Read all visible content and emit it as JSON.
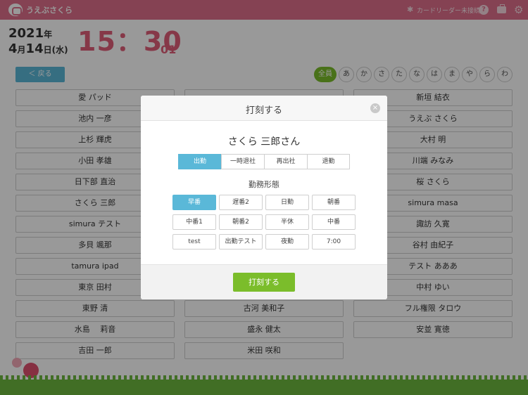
{
  "header": {
    "app_name": "うえぶさくら",
    "card_reader_status": "カードリーダー未接続",
    "help_label": "?",
    "bluetooth_glyph": "✱",
    "settings_glyph": "⚙"
  },
  "clock": {
    "year": "2021",
    "year_unit": "年",
    "month": "4",
    "month_unit": "月",
    "day": "14",
    "day_unit": "日",
    "weekday": "(水)",
    "time": "15：30",
    "seconds": "01"
  },
  "back_button": {
    "label": "＜ 戻る"
  },
  "kana_filter": [
    "全員",
    "あ",
    "か",
    "さ",
    "た",
    "な",
    "は",
    "ま",
    "や",
    "ら",
    "わ"
  ],
  "employees": {
    "col1": [
      "愛 パッド",
      "池内 一彦",
      "上杉 輝虎",
      "小田 孝雄",
      "日下部 直治",
      "さくら 三郎",
      "simura テスト",
      "多貝 颯那",
      "tamura ipad",
      "東京 田村",
      "東野 清",
      "水島　 莉音",
      "吉田 一郎"
    ],
    "col2": [
      "古河 美和子",
      "盛永 健太",
      "米田 咲和"
    ],
    "col3": [
      "新垣 結衣",
      "うえぶ さくら",
      "大村 明",
      "川端 みなみ",
      "桜 さくら",
      "simura masa",
      "諏訪 久寛",
      "谷村 由紀子",
      "テスト あああ",
      "中村 ゆい",
      "フル権限 タロウ",
      "安並 寛徳"
    ]
  },
  "modal": {
    "title": "打刻する",
    "close_glyph": "×",
    "person": "さくら 三郎さん",
    "punch_types": [
      "出勤",
      "一時退社",
      "再出社",
      "退勤"
    ],
    "work_type_title": "勤務形態",
    "shifts": [
      "早番",
      "遅番2",
      "日勤",
      "朝番",
      "中番1",
      "朝番2",
      "半休",
      "中番",
      "test",
      "出勤テスト",
      "夜勤",
      "7:00"
    ],
    "submit": "打刻する"
  },
  "colors": {
    "header": "#de6f8a",
    "time": "#e05e79",
    "accent_blue": "#5ab8d8",
    "accent_green": "#7bbd2b"
  }
}
